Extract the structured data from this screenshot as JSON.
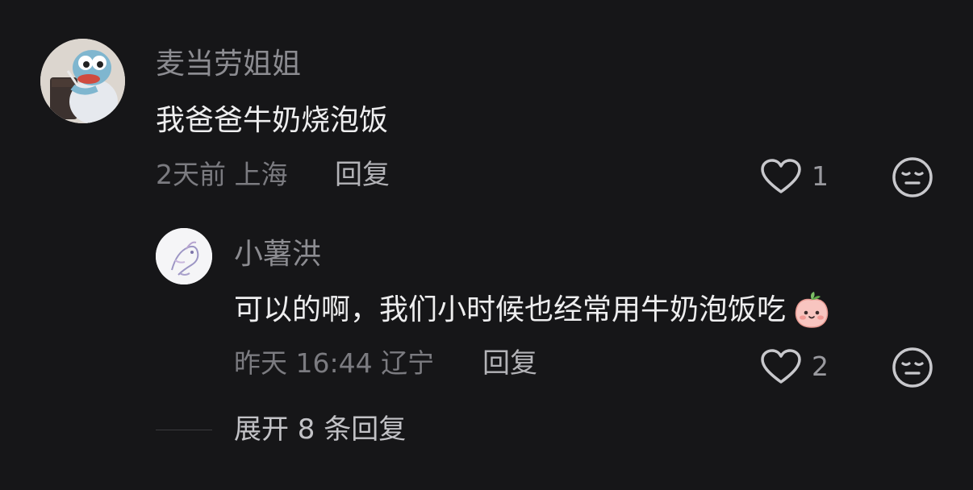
{
  "comment": {
    "username": "麦当劳姐姐",
    "text": "我爸爸牛奶烧泡饭",
    "time_location": "2天前 上海",
    "reply_label": "回复",
    "like_count": "1",
    "avatar_icon": "cartoon-mascot-with-drink",
    "like_icon": "heart-outline",
    "dislike_icon": "neutral-face-outline"
  },
  "reply": {
    "username": "小薯洪",
    "text": "可以的啊，我们小时候也经常用牛奶泡饭吃",
    "emoji": "peach-face-emoji",
    "time_location": "昨天 16:44 辽宁",
    "reply_label": "回复",
    "like_count": "2",
    "avatar_icon": "sketch-drawing",
    "like_icon": "heart-outline",
    "dislike_icon": "neutral-face-outline"
  },
  "expand_replies": {
    "label": "展开 8 条回复"
  },
  "colors": {
    "background": "#161618",
    "primary_text": "#eeeeef",
    "secondary_text": "#8c8c91",
    "icon": "#c8c8cc"
  }
}
